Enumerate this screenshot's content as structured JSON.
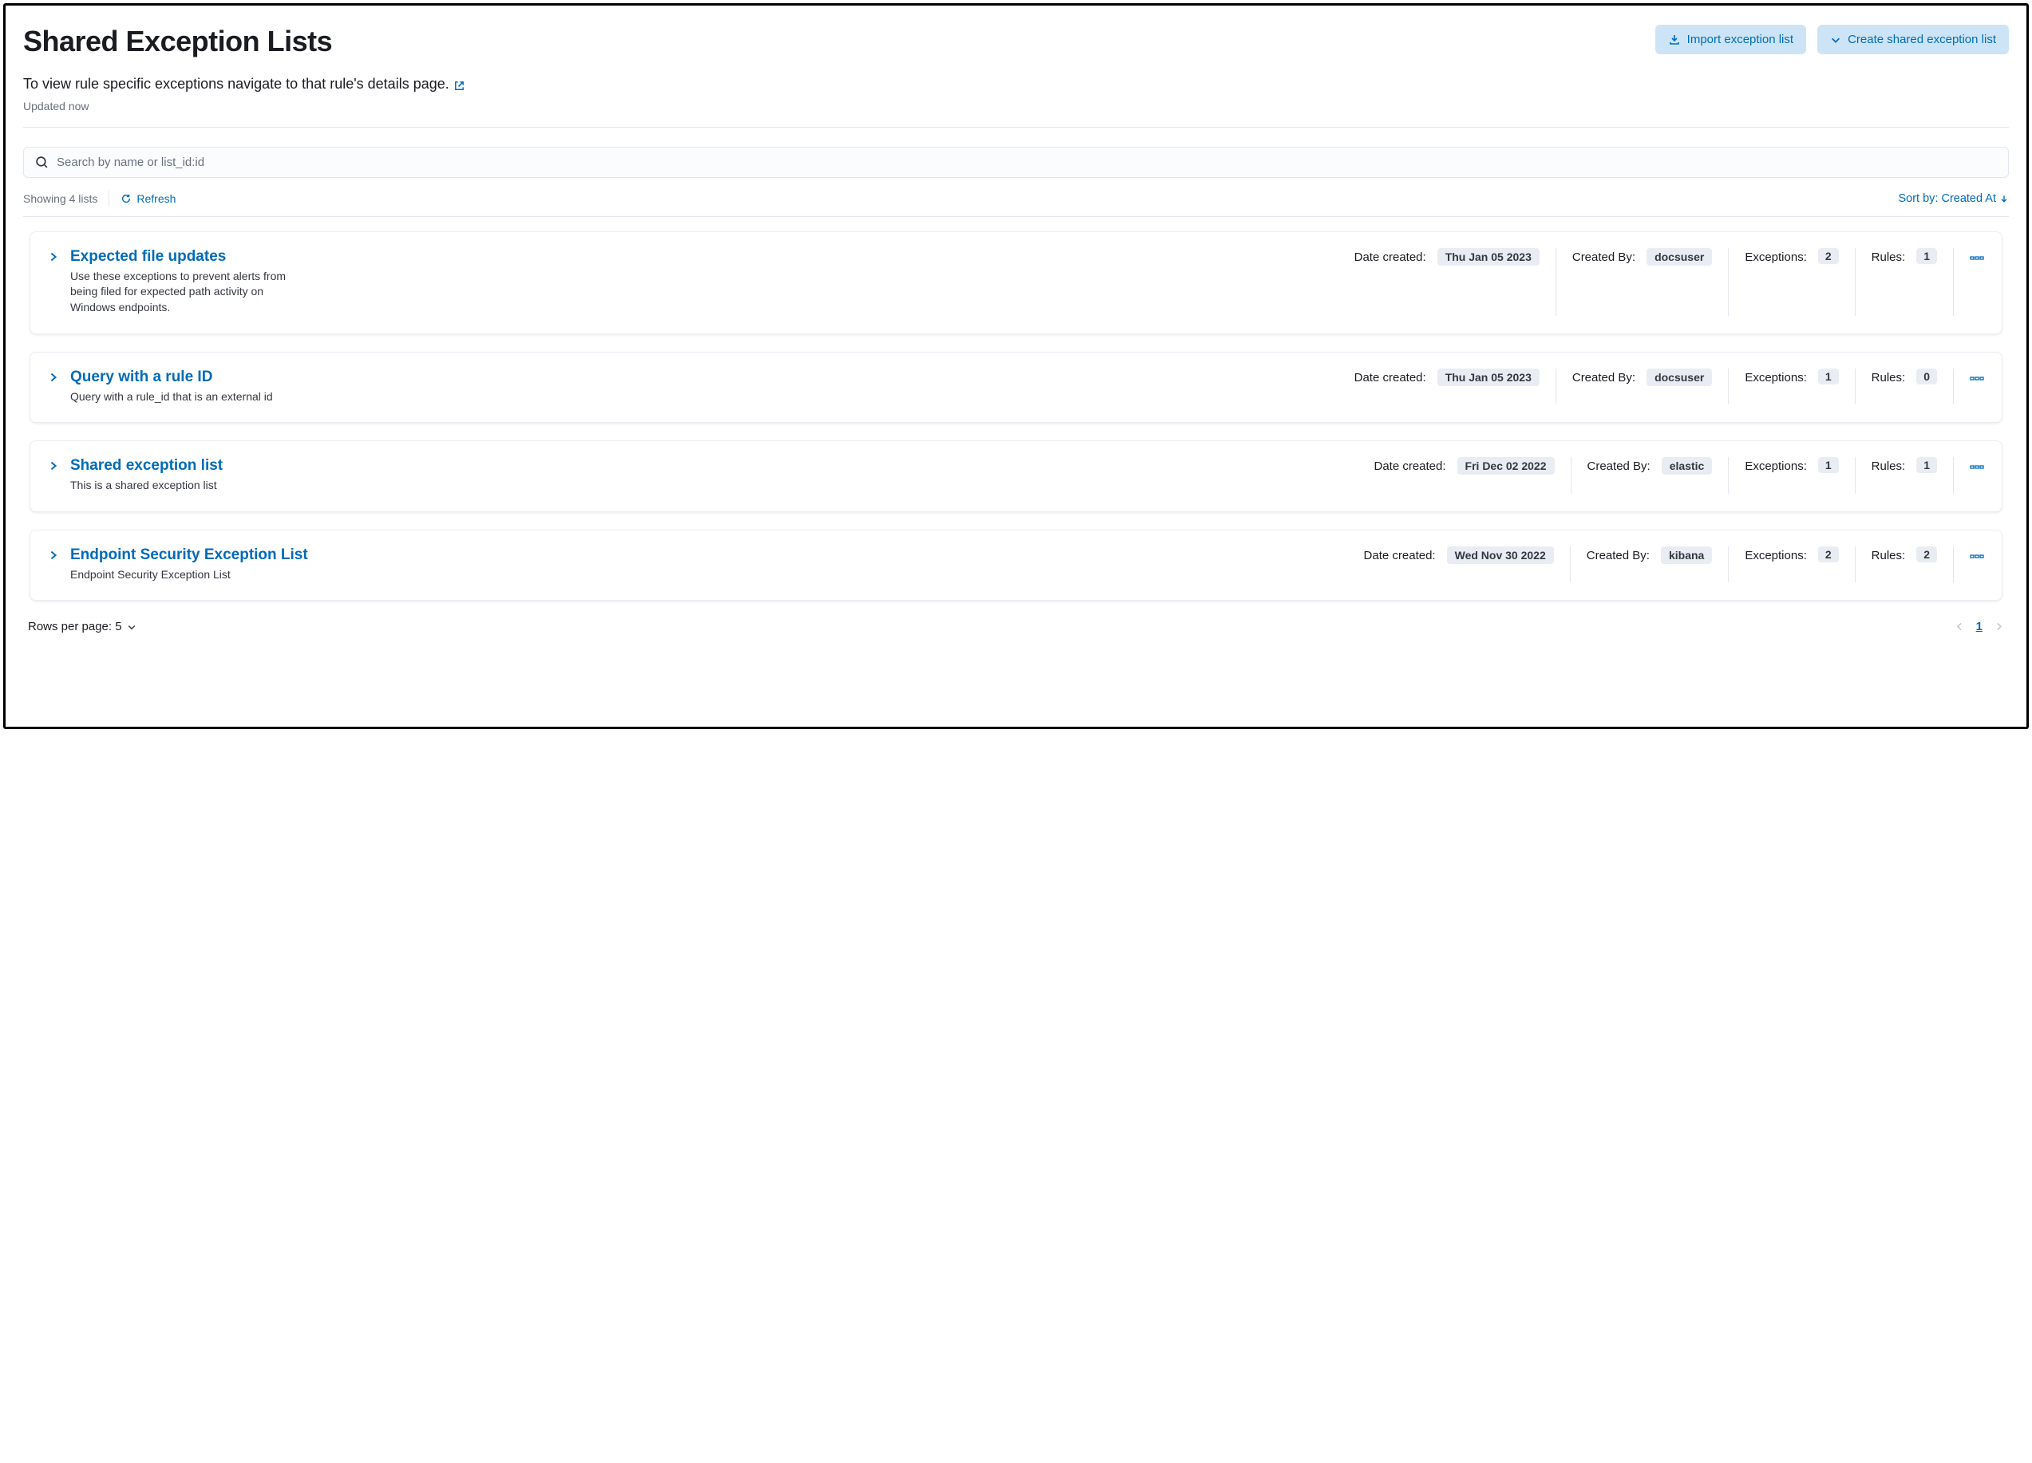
{
  "header": {
    "title": "Shared Exception Lists",
    "import_btn": "Import exception list",
    "create_btn": "Create shared exception list"
  },
  "subtitle": "To view rule specific exceptions navigate to that rule's details page.",
  "updated_text": "Updated now",
  "search": {
    "placeholder": "Search by name or list_id:id"
  },
  "toolbar": {
    "showing": "Showing 4 lists",
    "refresh": "Refresh",
    "sort": "Sort by: Created At"
  },
  "labels": {
    "date_created": "Date created:",
    "created_by": "Created By:",
    "exceptions": "Exceptions:",
    "rules": "Rules:"
  },
  "lists": [
    {
      "title": "Expected file updates",
      "desc": "Use these exceptions to prevent alerts from being filed for expected path activity on Windows endpoints.",
      "date": "Thu Jan 05 2023",
      "by": "docsuser",
      "exceptions": "2",
      "rules": "1"
    },
    {
      "title": "Query with a rule ID",
      "desc": "Query with a rule_id that is an external id",
      "date": "Thu Jan 05 2023",
      "by": "docsuser",
      "exceptions": "1",
      "rules": "0"
    },
    {
      "title": "Shared exception list",
      "desc": "This is a shared exception list",
      "date": "Fri Dec 02 2022",
      "by": "elastic",
      "exceptions": "1",
      "rules": "1"
    },
    {
      "title": "Endpoint Security Exception List",
      "desc": "Endpoint Security Exception List",
      "date": "Wed Nov 30 2022",
      "by": "kibana",
      "exceptions": "2",
      "rules": "2"
    }
  ],
  "footer": {
    "rows_per_page": "Rows per page: 5",
    "current_page": "1"
  }
}
